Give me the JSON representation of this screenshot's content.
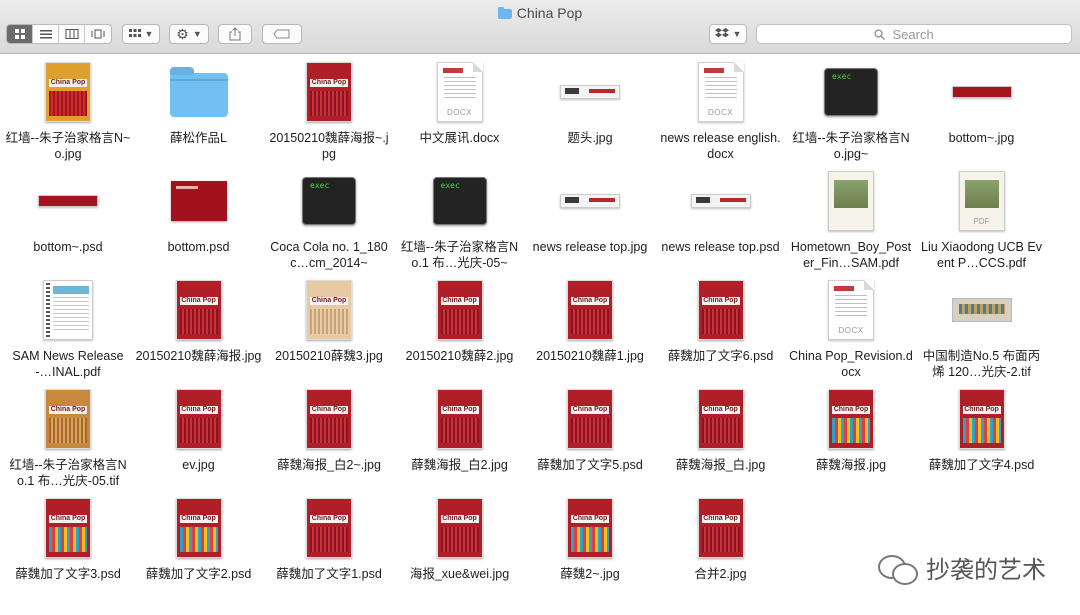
{
  "window": {
    "title": "China Pop"
  },
  "toolbar": {
    "view_modes": [
      "icon-view",
      "list-view",
      "column-view",
      "cover-flow-view"
    ],
    "search_placeholder": "Search"
  },
  "files": [
    {
      "name": "红墙--朱子治家格言N~o.jpg",
      "thumb": "poster-orange"
    },
    {
      "name": "薛松作品L",
      "thumb": "folder"
    },
    {
      "name": "20150210魏薛海报~.jpg",
      "thumb": "poster"
    },
    {
      "name": "中文展讯.docx",
      "thumb": "doc-docx",
      "ext": "DOCX"
    },
    {
      "name": "题头.jpg",
      "thumb": "banner"
    },
    {
      "name": "news release english.docx",
      "thumb": "doc-docx",
      "ext": "DOCX"
    },
    {
      "name": "红墙--朱子治家格言No.jpg~",
      "thumb": "exec",
      "exec_text": "exec"
    },
    {
      "name": "bottom~.jpg",
      "thumb": "banner-red"
    },
    {
      "name": "bottom~.psd",
      "thumb": "banner-red"
    },
    {
      "name": "bottom.psd",
      "thumb": "redcard"
    },
    {
      "name": "Coca Cola no. 1_180c…cm_2014~",
      "thumb": "exec",
      "exec_text": "exec"
    },
    {
      "name": "红墙--朱子治家格言No.1 布…光庆-05~",
      "thumb": "exec",
      "exec_text": "exec"
    },
    {
      "name": "news release top.jpg",
      "thumb": "banner"
    },
    {
      "name": "news release top.psd",
      "thumb": "banner"
    },
    {
      "name": "Hometown_Boy_Poster_Fin…SAM.pdf",
      "thumb": "pdf"
    },
    {
      "name": "Liu Xiaodong UCB Event P…CCS.pdf",
      "thumb": "pdf",
      "ext": "PDF"
    },
    {
      "name": "SAM News Release-…INAL.pdf",
      "thumb": "news"
    },
    {
      "name": "20150210魏薛海报.jpg",
      "thumb": "poster"
    },
    {
      "name": "20150210薛魏3.jpg",
      "thumb": "poster-beige"
    },
    {
      "name": "20150210魏薛2.jpg",
      "thumb": "poster"
    },
    {
      "name": "20150210魏薛1.jpg",
      "thumb": "poster"
    },
    {
      "name": "薛魏加了文字6.psd",
      "thumb": "poster"
    },
    {
      "name": "China Pop_Revision.docx",
      "thumb": "doc-docx",
      "ext": "DOCX"
    },
    {
      "name": "中国制造No.5 布面丙烯 120…光庆-2.tif",
      "thumb": "fabric"
    },
    {
      "name": "红墙--朱子治家格言No.1 布…光庆-05.tif",
      "thumb": "poster-bronze"
    },
    {
      "name": "ev.jpg",
      "thumb": "poster"
    },
    {
      "name": "薛魏海报_白2~.jpg",
      "thumb": "poster"
    },
    {
      "name": "薛魏海报_白2.jpg",
      "thumb": "poster"
    },
    {
      "name": "薛魏加了文字5.psd",
      "thumb": "poster"
    },
    {
      "name": "薛魏海报_白.jpg",
      "thumb": "poster"
    },
    {
      "name": "薛魏海报.jpg",
      "thumb": "poster-color"
    },
    {
      "name": "薛魏加了文字4.psd",
      "thumb": "poster-color"
    },
    {
      "name": "薛魏加了文字3.psd",
      "thumb": "poster-color"
    },
    {
      "name": "薛魏加了文字2.psd",
      "thumb": "poster-color"
    },
    {
      "name": "薛魏加了文字1.psd",
      "thumb": "poster"
    },
    {
      "name": "海报_xue&wei.jpg",
      "thumb": "poster"
    },
    {
      "name": "薛魏2~.jpg",
      "thumb": "poster-color"
    },
    {
      "name": "合并2.jpg",
      "thumb": "poster"
    }
  ],
  "poster_text": "China Pop",
  "watermark": {
    "text": "抄袭的艺术",
    "icon": "wechat-icon"
  },
  "colors": {
    "folder": "#73bff1",
    "poster_red": "#b01e28",
    "exec_green": "#49d14a"
  }
}
